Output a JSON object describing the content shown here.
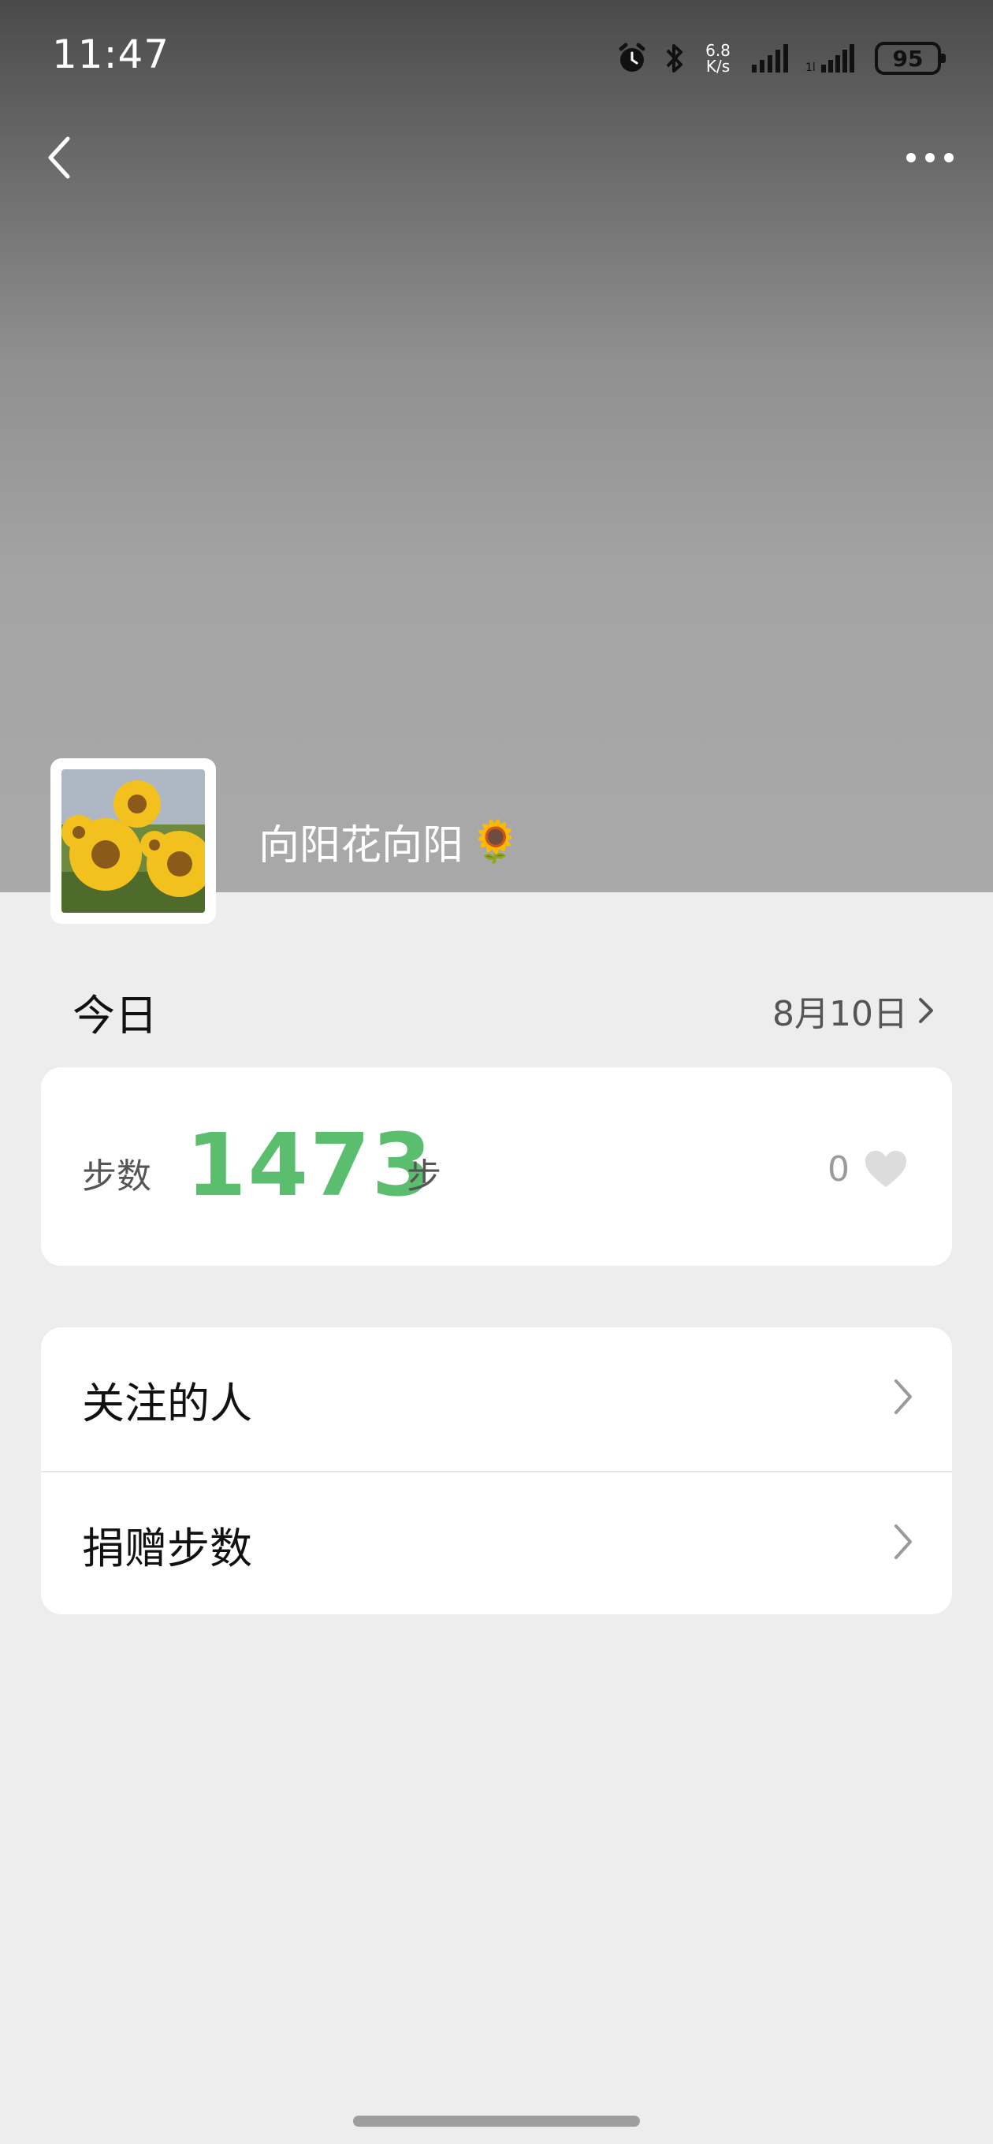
{
  "status_bar": {
    "time": "11:47",
    "net_speed_value": "6.8",
    "net_speed_unit": "K/s",
    "battery": "95",
    "icons": [
      "alarm-icon",
      "bluetooth-icon",
      "signal-icon",
      "signal-icon"
    ]
  },
  "nav": {
    "back_icon": "chevron-left-icon",
    "more_icon": "more-dots-icon"
  },
  "profile": {
    "username": "向阳花向阳",
    "username_emoji": "🌻",
    "avatar": "sunflower-photo"
  },
  "today": {
    "label": "今日",
    "date": "8月10日"
  },
  "steps": {
    "label": "步数",
    "value": "1473",
    "unit": "步",
    "likes": "0",
    "accent_color": "#5bbd6e"
  },
  "menu": {
    "items": [
      {
        "label": "关注的人"
      },
      {
        "label": "捐赠步数"
      }
    ]
  }
}
